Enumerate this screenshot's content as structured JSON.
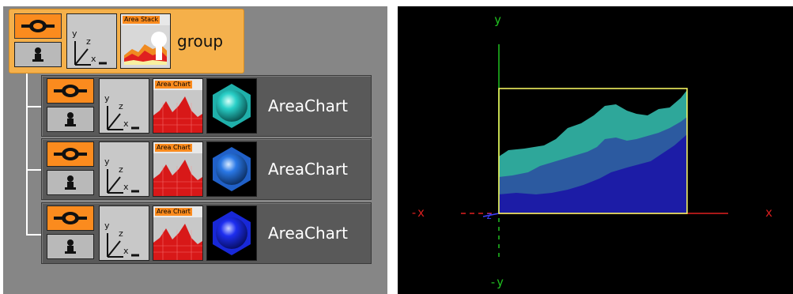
{
  "scene_tree": {
    "group_node": {
      "chart_tag": "Area Stack",
      "label": "group"
    },
    "children": [
      {
        "chart_tag": "Area Chart",
        "label": "AreaChart",
        "material_color": "#29d0c8"
      },
      {
        "chart_tag": "Area Chart",
        "label": "AreaChart",
        "material_color": "#2a78e6"
      },
      {
        "chart_tag": "Area Chart",
        "label": "AreaChart",
        "material_color": "#1d2ef0"
      }
    ],
    "icons": [
      "eye-icon",
      "lock-icon",
      "axis-icon",
      "area-chart-thumbnail",
      "material-sphere-icon"
    ]
  },
  "viewport": {
    "axis_labels": {
      "y": "y",
      "neg_y": "-y",
      "x": "x",
      "neg_x": "-x",
      "z": "z"
    },
    "colors": {
      "x_axis": "#e02020",
      "y_axis": "#20c020",
      "z_axis": "#4040ff",
      "bounding_box": "#ffff66",
      "layer_top": "#2ea79a",
      "layer_middle": "#2c5aa0",
      "layer_bottom": "#1c1ca6"
    }
  }
}
